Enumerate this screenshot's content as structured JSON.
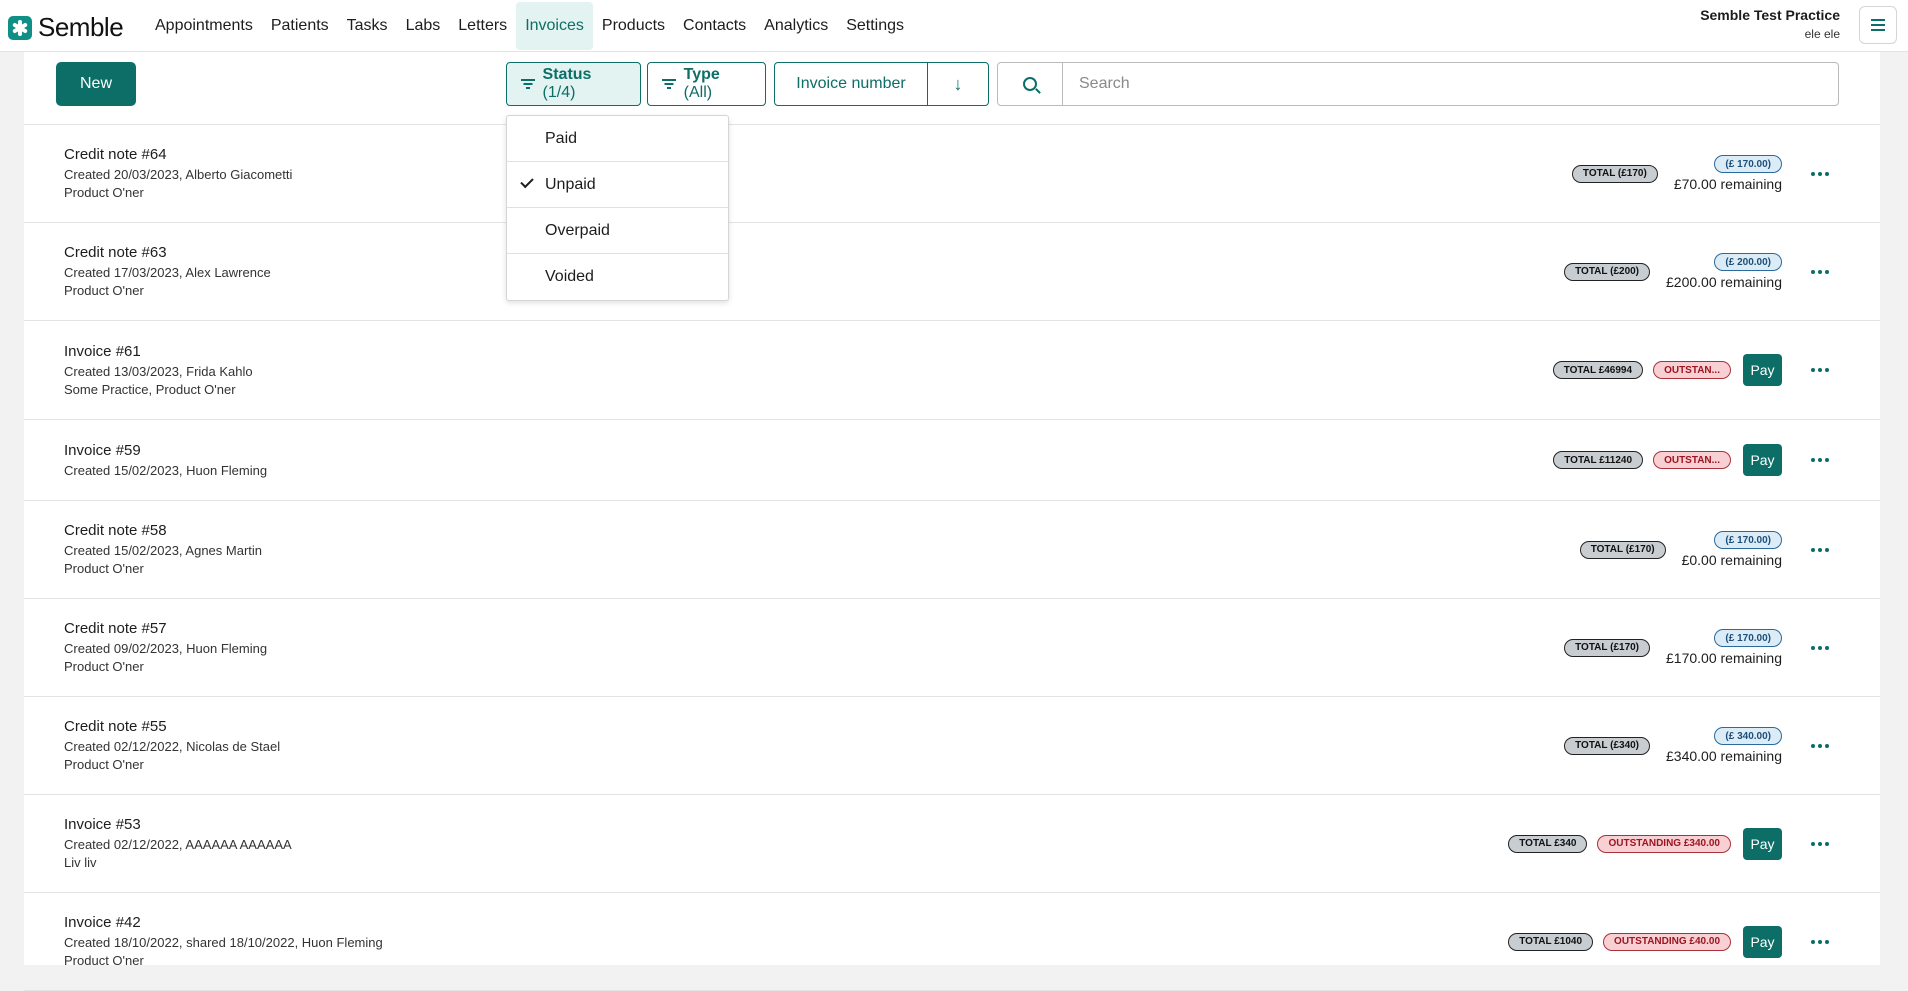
{
  "app": {
    "logo_text": "Semble"
  },
  "nav": [
    "Appointments",
    "Patients",
    "Tasks",
    "Labs",
    "Letters",
    "Invoices",
    "Products",
    "Contacts",
    "Analytics",
    "Settings"
  ],
  "nav_active": "Invoices",
  "practice": {
    "name": "Semble Test Practice",
    "user": "ele ele"
  },
  "toolbar": {
    "new_label": "New",
    "status_label": "Status",
    "status_count": "(1/4)",
    "type_label": "Type",
    "type_value": "(All)",
    "sort_label": "Invoice number",
    "sort_direction_glyph": "↓",
    "search_placeholder": "Search"
  },
  "status_dropdown": {
    "options": [
      {
        "label": "Paid",
        "checked": false
      },
      {
        "label": "Unpaid",
        "checked": true
      },
      {
        "label": "Overpaid",
        "checked": false
      },
      {
        "label": "Voided",
        "checked": false
      }
    ]
  },
  "rows": [
    {
      "kind": "credit",
      "title": "Credit note #64",
      "created": "Created 20/03/2023, Alberto Giacometti",
      "detail": "Product O'ner",
      "total": "TOTAL (£170)",
      "badge": "(£ 170.00)",
      "remaining": "£70.00 remaining"
    },
    {
      "kind": "credit",
      "title": "Credit note #63",
      "created": "Created 17/03/2023, Alex Lawrence",
      "detail": "Product O'ner",
      "total": "TOTAL (£200)",
      "badge": "(£ 200.00)",
      "remaining": "£200.00 remaining"
    },
    {
      "kind": "invoice",
      "title": "Invoice #61",
      "created": "Created 13/03/2023, Frida Kahlo",
      "detail": "Some Practice, Product O'ner",
      "total": "TOTAL £46994",
      "status": "OUTSTAN...",
      "pay": "Pay"
    },
    {
      "kind": "invoice",
      "title": "Invoice #59",
      "created": "Created 15/02/2023, Huon Fleming",
      "detail": "",
      "total": "TOTAL £11240",
      "status": "OUTSTAN...",
      "pay": "Pay"
    },
    {
      "kind": "credit",
      "title": "Credit note #58",
      "created": "Created 15/02/2023, Agnes Martin",
      "detail": "Product O'ner",
      "total": "TOTAL (£170)",
      "badge": "(£ 170.00)",
      "remaining": "£0.00 remaining"
    },
    {
      "kind": "credit",
      "title": "Credit note #57",
      "created": "Created 09/02/2023, Huon Fleming",
      "detail": "Product O'ner",
      "total": "TOTAL (£170)",
      "badge": "(£ 170.00)",
      "remaining": "£170.00 remaining"
    },
    {
      "kind": "credit",
      "title": "Credit note #55",
      "created": "Created 02/12/2022, Nicolas de Stael",
      "detail": "Product O'ner",
      "total": "TOTAL (£340)",
      "badge": "(£ 340.00)",
      "remaining": "£340.00 remaining"
    },
    {
      "kind": "invoice",
      "title": "Invoice #53",
      "created": "Created 02/12/2022, AAAAAA AAAAAA",
      "detail": "Liv liv",
      "total": "TOTAL £340",
      "status": "OUTSTANDING £340.00",
      "pay": "Pay"
    },
    {
      "kind": "invoice",
      "title": "Invoice #42",
      "created": "Created 18/10/2022, shared 18/10/2022, Huon Fleming",
      "detail": "Product O'ner",
      "total": "TOTAL £1040",
      "status": "OUTSTANDING £40.00",
      "pay": "Pay"
    }
  ],
  "colors": {
    "brand": "#0c6e67",
    "nav_active_bg": "#e3f3f1",
    "outstanding_bg": "#f8d0d3",
    "credit_badge_bg": "#dcecf7"
  },
  "icons": {
    "logo": "semble-logo-icon",
    "menu": "hamburger-icon",
    "filter": "filter-icon",
    "search": "search-icon",
    "sort": "arrow-down-icon",
    "check": "check-icon",
    "more": "more-horizontal-icon"
  }
}
